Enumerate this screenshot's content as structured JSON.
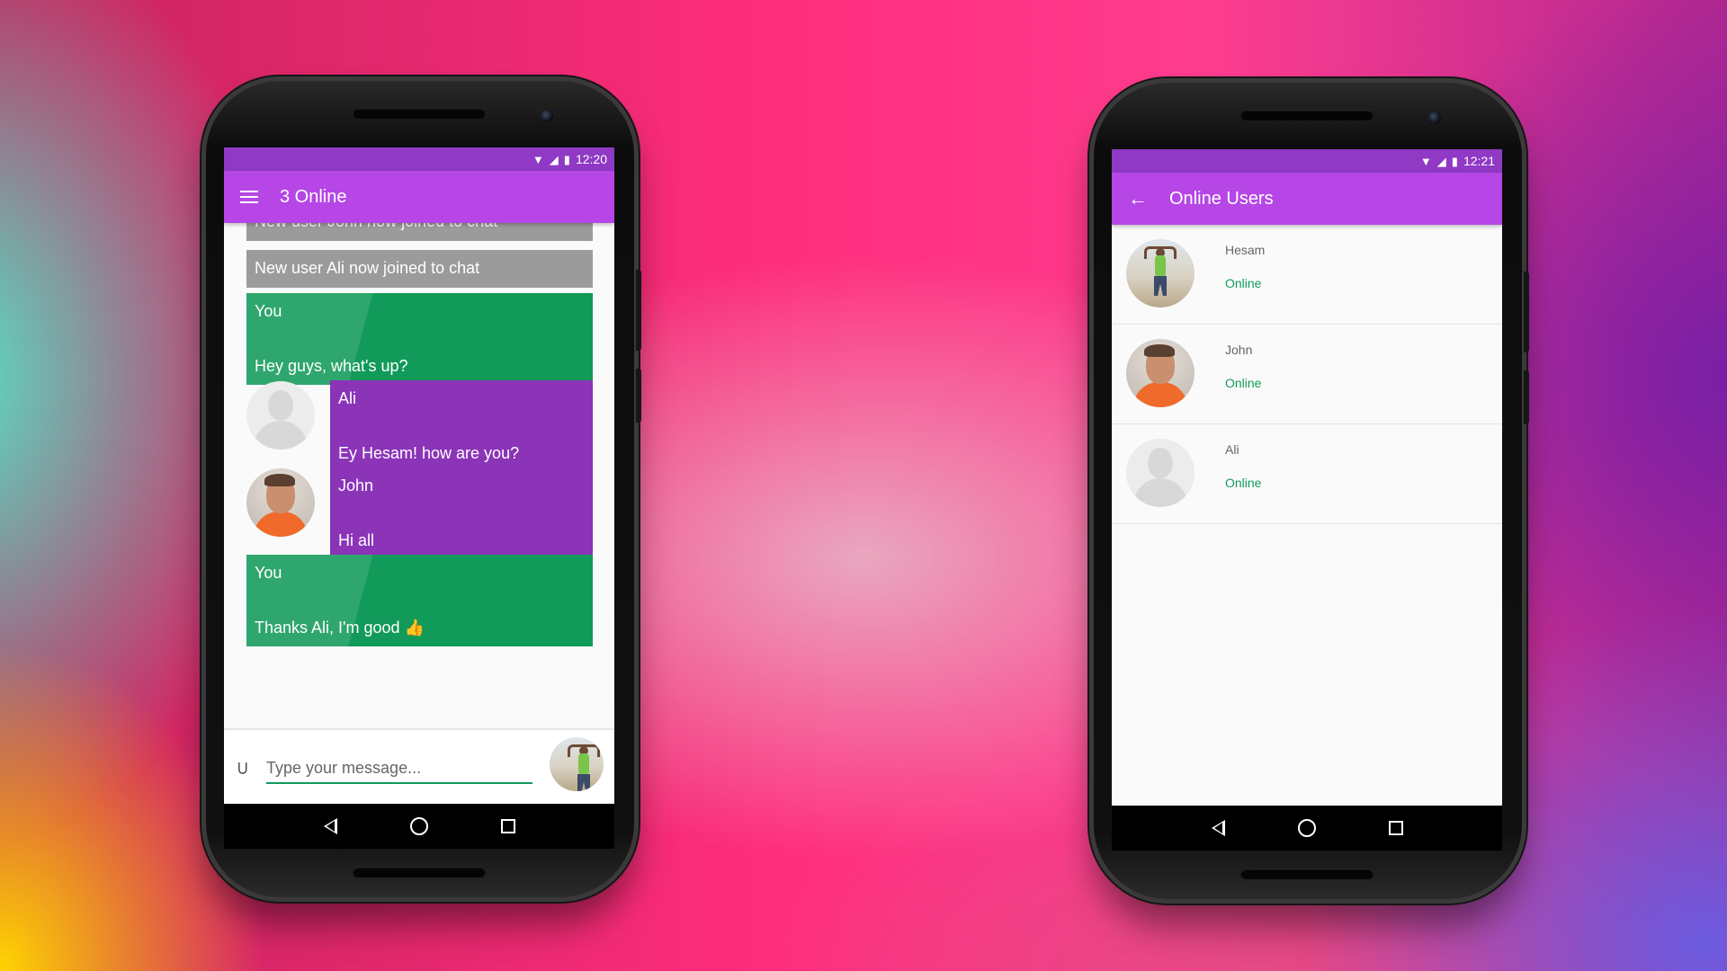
{
  "colors": {
    "primary": "#b646e6",
    "primary_dark": "#8f39c5",
    "you_bubble": "#129a5a",
    "other_bubble": "#8b34b8",
    "system_bubble": "#9b9b9b",
    "online_text": "#129a5a"
  },
  "left_phone": {
    "status": {
      "time": "12:20",
      "icons": [
        "wifi-icon",
        "signal-icon",
        "battery-icon"
      ]
    },
    "appbar": {
      "title": "3 Online",
      "icon": "menu-icon"
    },
    "messages": [
      {
        "type": "system",
        "text": "New user John now joined to chat"
      },
      {
        "type": "system",
        "text": "New user Ali now joined to chat"
      },
      {
        "type": "you",
        "sender": "You",
        "text": "Hey guys, what's up?"
      },
      {
        "type": "other",
        "sender": "Ali",
        "text": "Ey Hesam! how are you?"
      },
      {
        "type": "other",
        "sender": "John",
        "text": "Hi all"
      },
      {
        "type": "you",
        "sender": "You",
        "text": "Thanks Ali, I'm good 👍"
      }
    ],
    "composer": {
      "placeholder": "Type your message...",
      "icon": "attachment-icon"
    }
  },
  "right_phone": {
    "status": {
      "time": "12:21",
      "icons": [
        "wifi-icon",
        "signal-icon",
        "battery-icon"
      ]
    },
    "appbar": {
      "title": "Online Users",
      "icon": "back-arrow-icon"
    },
    "users": [
      {
        "name": "Hesam",
        "status": "Online"
      },
      {
        "name": "John",
        "status": "Online"
      },
      {
        "name": "Ali",
        "status": "Online"
      }
    ]
  }
}
